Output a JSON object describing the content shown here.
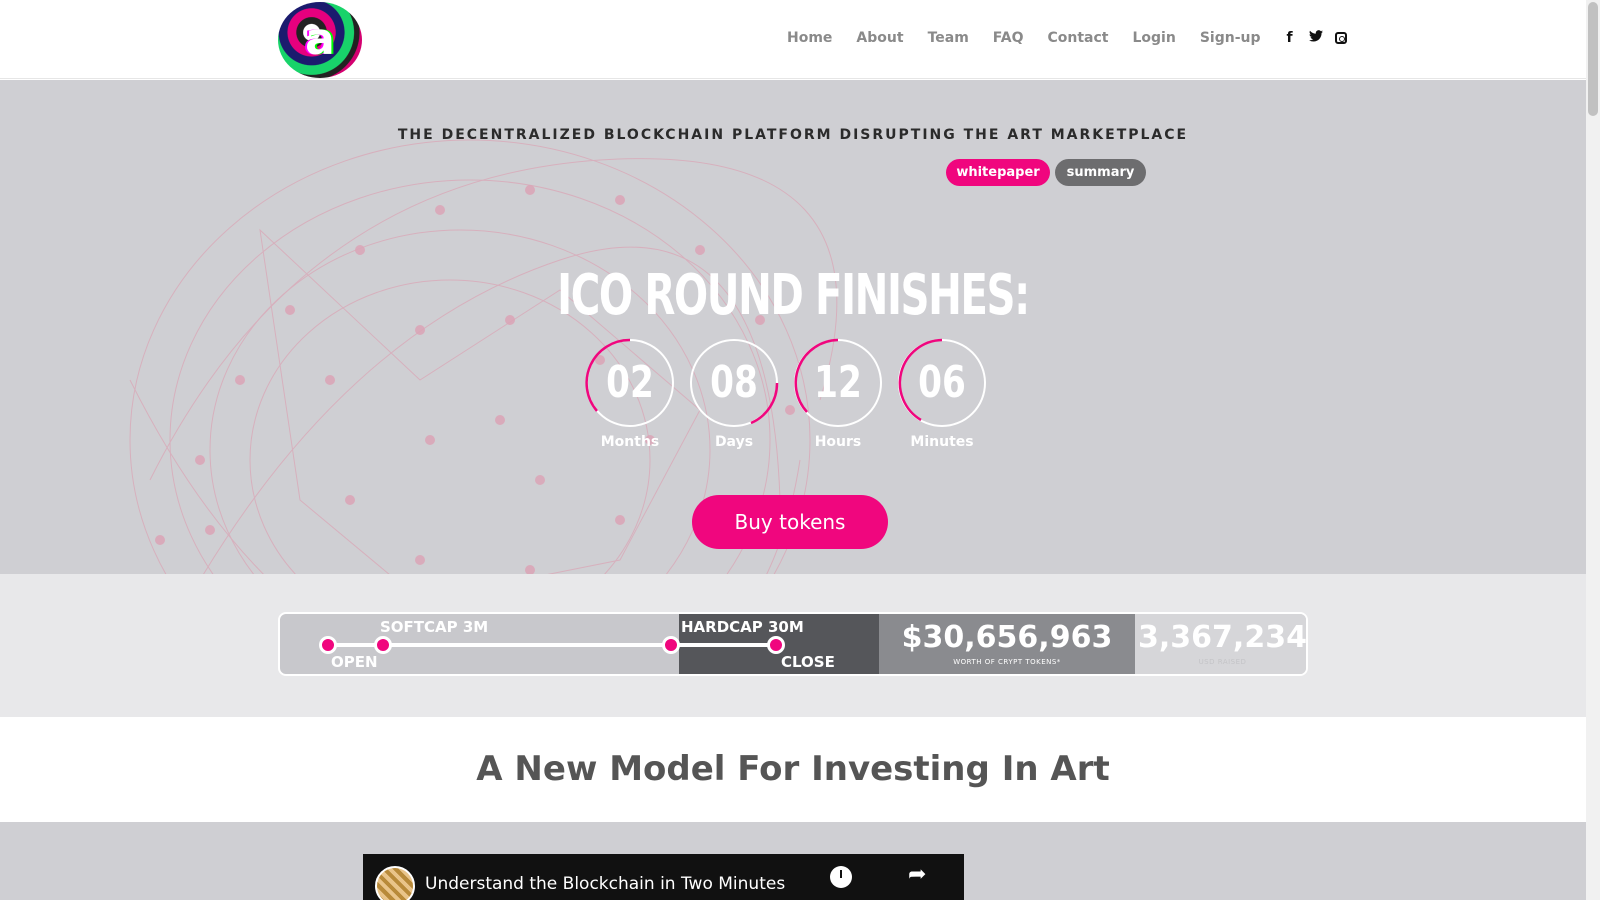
{
  "header": {
    "logo_letter": "a",
    "nav": [
      "Home",
      "About",
      "Team",
      "FAQ",
      "Contact",
      "Login",
      "Sign-up"
    ],
    "social": {
      "facebook": "f",
      "twitter": "t"
    },
    "social_icons": [
      "facebook-icon",
      "twitter-icon",
      "instagram-icon"
    ]
  },
  "hero": {
    "tagline": "THE DECENTRALIZED BLOCKCHAIN PLATFORM DISRUPTING THE ART MARKETPLACE",
    "whitepaper_label": "whitepaper",
    "summary_label": "summary",
    "countdown_title": "ICO ROUND FINISHES:",
    "countdown": [
      {
        "value": "02",
        "label": "Months"
      },
      {
        "value": "08",
        "label": "Days"
      },
      {
        "value": "12",
        "label": "Hours"
      },
      {
        "value": "06",
        "label": "Minutes"
      }
    ],
    "buy_label": "Buy tokens"
  },
  "progress": {
    "softcap_label": "SOFTCAP 3M",
    "hardcap_label": "HARDCAP 30M",
    "open_label": "OPEN",
    "close_label": "CLOSE",
    "tokens_amount": "$30,656,963",
    "tokens_caption": "WORTH OF CRYPT TOKENS*",
    "usd_amount": "3,367,234",
    "usd_caption": "USD RAISED"
  },
  "model": {
    "title": "A New Model For Investing In Art"
  },
  "video": {
    "title": "Understand the Blockchain in Two Minutes",
    "share_glyph": "➦"
  },
  "colors": {
    "accent": "#f0067e",
    "hero_bg": "#cfcfd3",
    "grey_pill": "#6d6d6f"
  }
}
